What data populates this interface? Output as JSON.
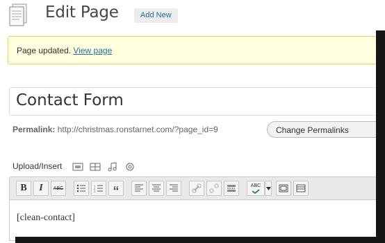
{
  "header": {
    "title": "Edit Page",
    "add_new_label": "Add New"
  },
  "notice": {
    "message": "Page updated.",
    "link_text": "View page"
  },
  "post": {
    "title": "Contact Form",
    "permalink_label": "Permalink:",
    "permalink_url": "http://christmas.ronstarnet.com/?page_id=9",
    "change_permalinks_label": "Change Permalinks"
  },
  "media": {
    "upload_insert_label": "Upload/Insert",
    "icons": [
      "image-icon",
      "video-icon",
      "audio-icon",
      "media-icon"
    ]
  },
  "toolbar": {
    "buttons": [
      {
        "name": "bold-button",
        "label": "B"
      },
      {
        "name": "italic-button",
        "label": "I"
      },
      {
        "name": "strikethrough-button",
        "label": "ABC"
      },
      {
        "name": "bullet-list-button",
        "label": ""
      },
      {
        "name": "numbered-list-button",
        "label": ""
      },
      {
        "name": "blockquote-button",
        "label": "“"
      },
      {
        "name": "align-left-button",
        "label": ""
      },
      {
        "name": "align-center-button",
        "label": ""
      },
      {
        "name": "align-right-button",
        "label": ""
      },
      {
        "name": "link-button",
        "label": ""
      },
      {
        "name": "unlink-button",
        "label": ""
      },
      {
        "name": "more-tag-button",
        "label": ""
      },
      {
        "name": "spellcheck-button",
        "label": "ABC"
      },
      {
        "name": "fullscreen-button",
        "label": ""
      },
      {
        "name": "kitchen-sink-button",
        "label": ""
      }
    ]
  },
  "editor": {
    "content": "[clean-contact]"
  },
  "colors": {
    "notice_bg": "#ffffe0",
    "notice_border": "#e6db55",
    "link": "#21759b",
    "toolbar_bg": "#e9e9e9"
  }
}
